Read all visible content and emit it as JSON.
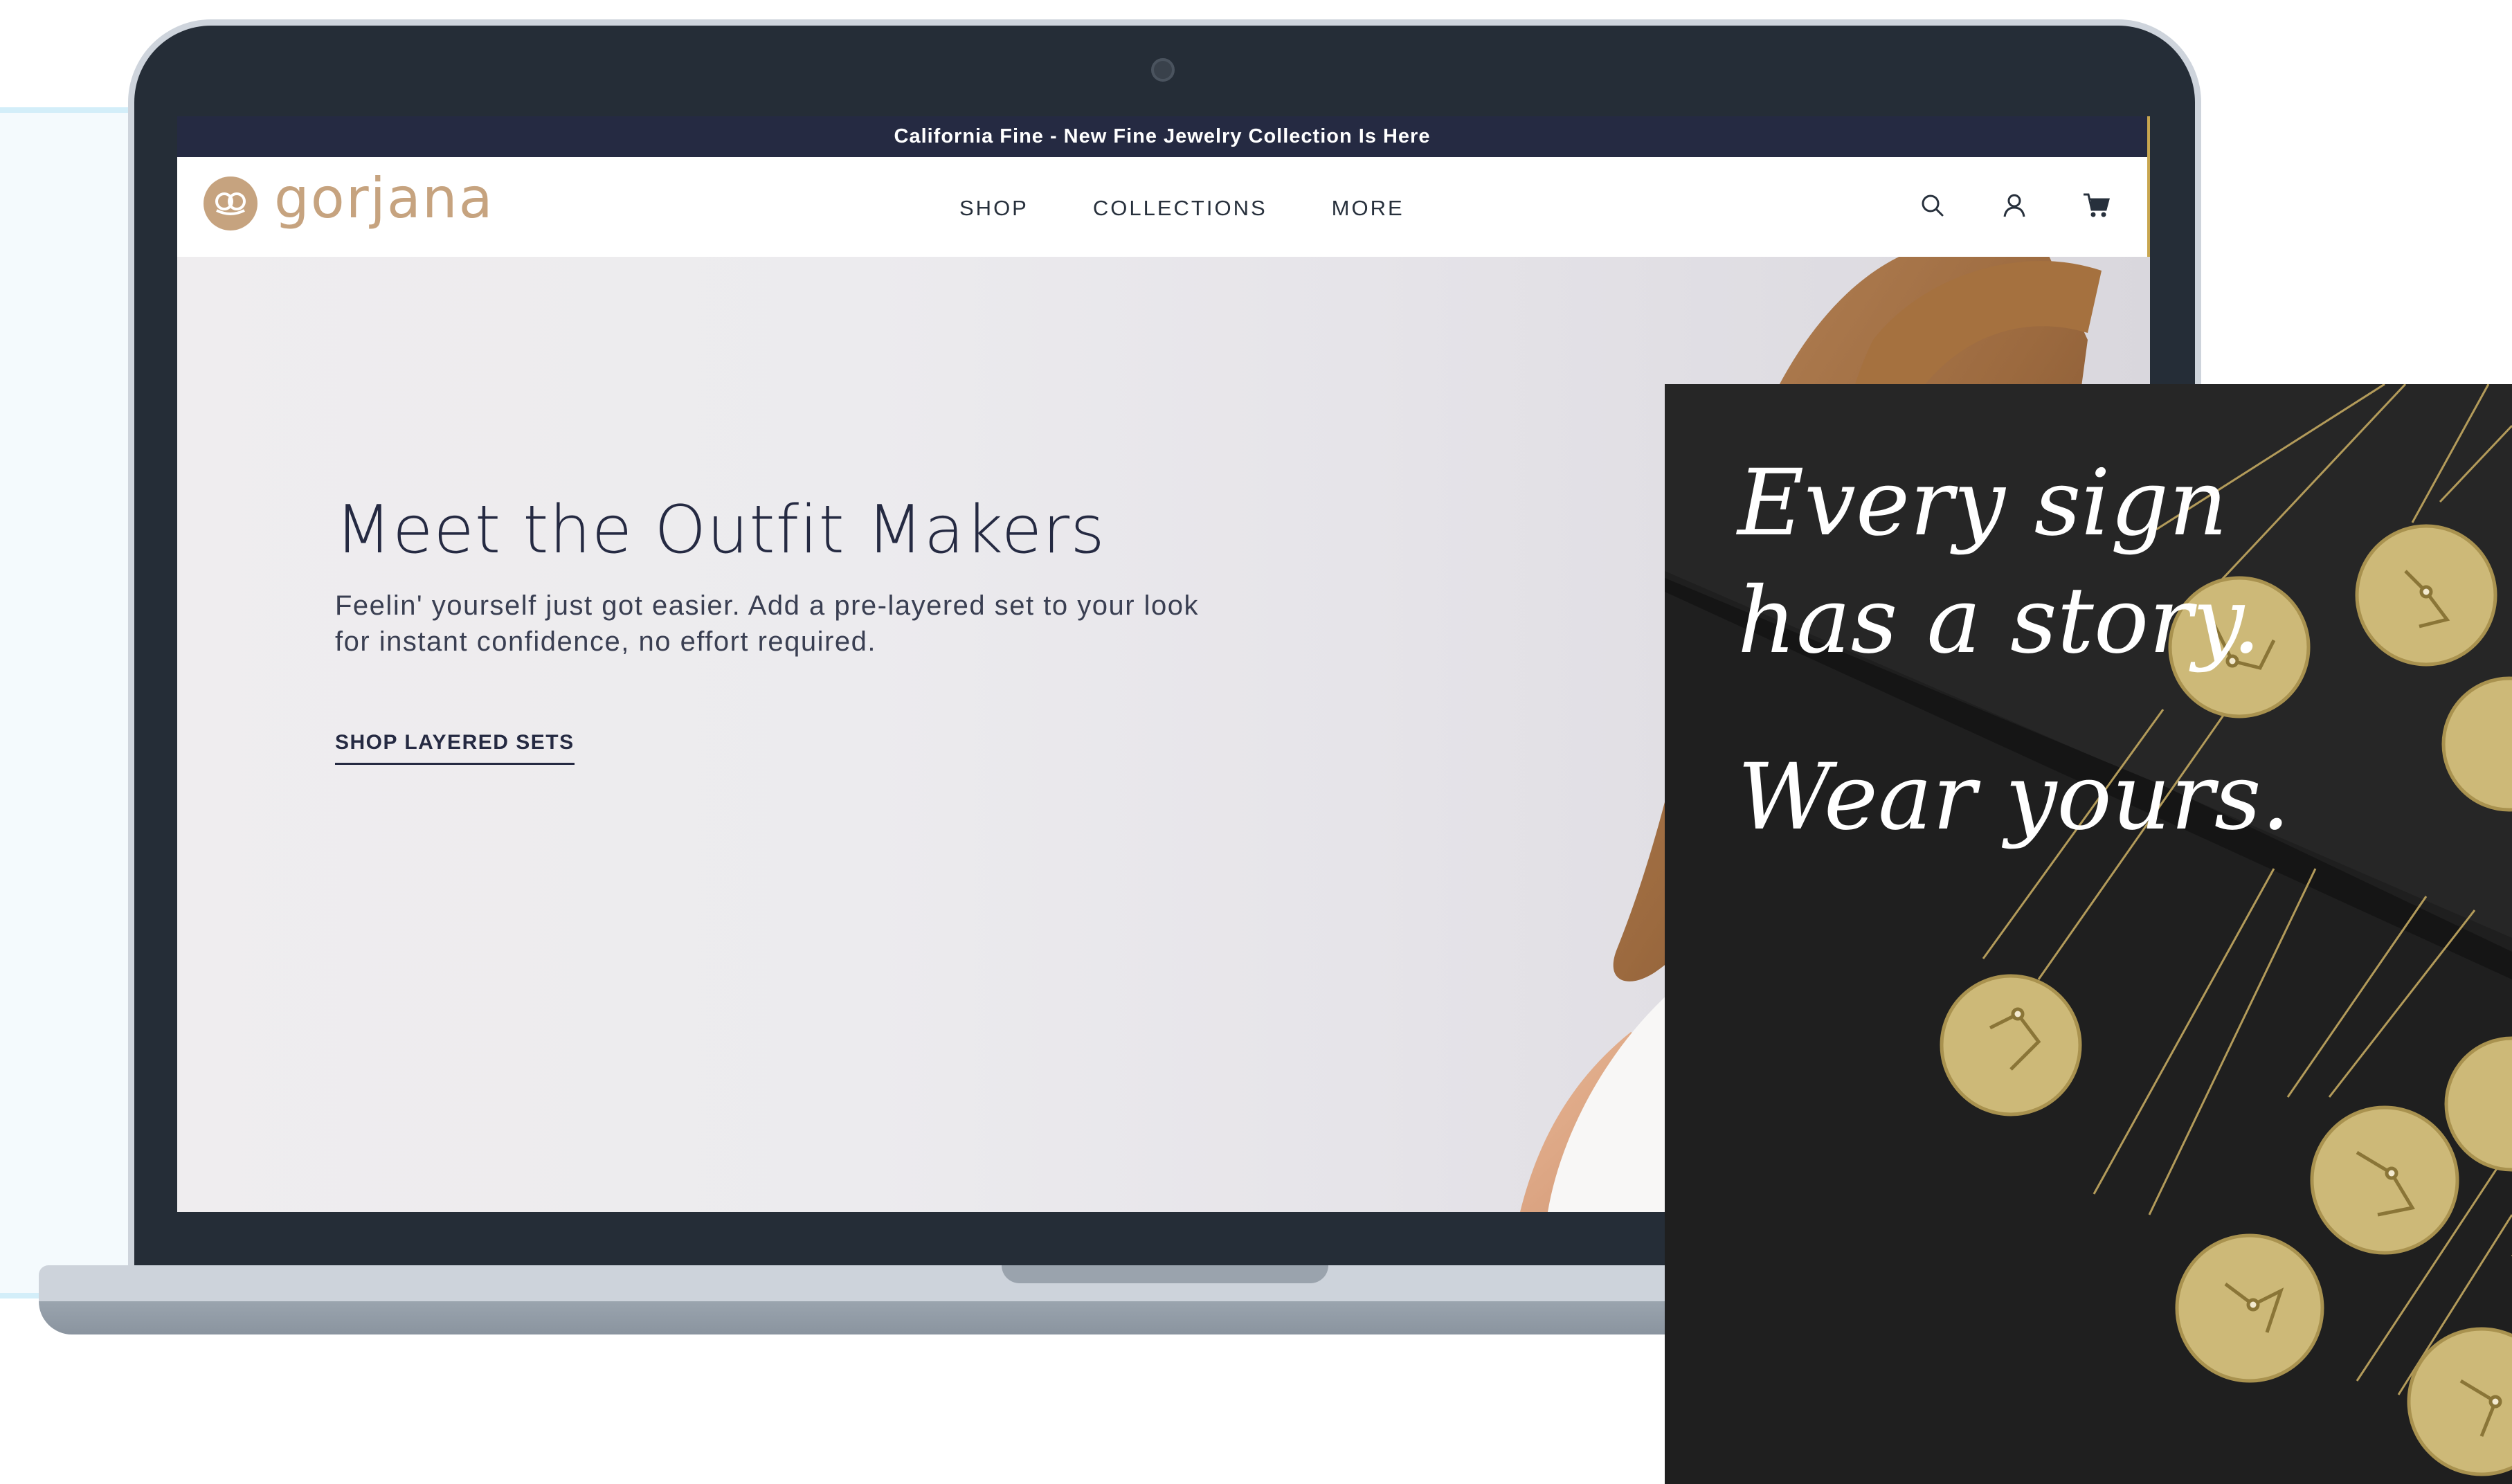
{
  "announcement": "California Fine - New Fine Jewelry Collection Is Here",
  "brand": {
    "name": "gorjana"
  },
  "nav": {
    "items": [
      "SHOP",
      "COLLECTIONS",
      "MORE"
    ]
  },
  "hero": {
    "title": "Meet the Outfit Makers",
    "subtitle_line1": "Feelin' yourself just got easier. Add a pre-layered set to your look",
    "subtitle_line2": "for instant confidence, no effort required.",
    "cta": "SHOP LAYERED SETS"
  },
  "promo": {
    "line1": "Every sign",
    "line2": "has a story.",
    "line3": "Wear yours."
  },
  "icons": [
    "search-icon",
    "account-icon",
    "cart-icon"
  ],
  "colors": {
    "announcement_bg": "#252a42",
    "brand_gold": "#c6a37f",
    "laptop_bezel": "#252d37",
    "promo_bg": "#1f1f1f",
    "pendant_gold": "#cdb978"
  }
}
